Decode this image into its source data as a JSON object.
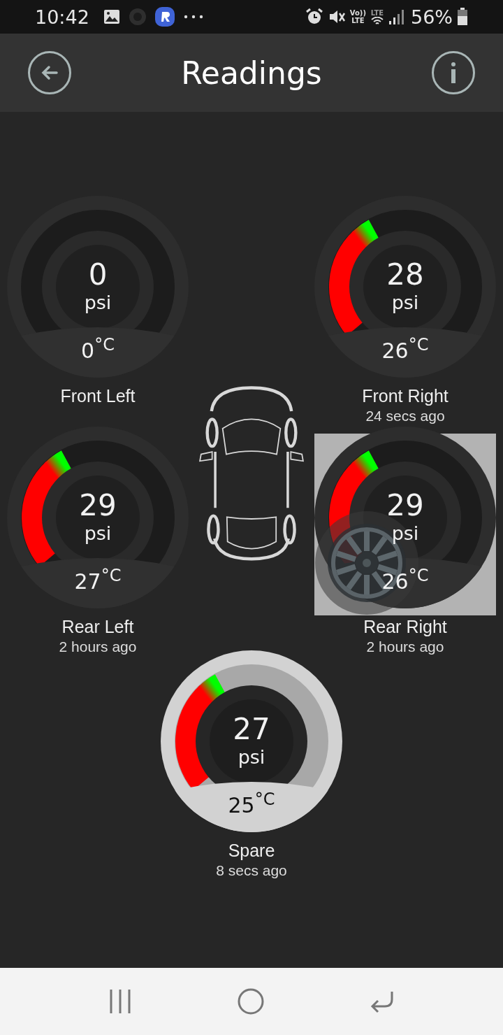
{
  "status_bar": {
    "time": "10:42",
    "network_labels": [
      "Vo))",
      "LTE",
      "LTE"
    ],
    "battery": "56%"
  },
  "app_bar": {
    "title": "Readings"
  },
  "tires": [
    {
      "name": "Front Left",
      "pressure": "0",
      "unit": "psi",
      "temperature": "0",
      "temp_unit": "°C",
      "active": false,
      "kind": "dark",
      "selected": false
    },
    {
      "name": "Front Right",
      "pressure": "28",
      "unit": "psi",
      "temperature": "26",
      "temp_unit": "°C",
      "updated": "24 secs ago",
      "active": true,
      "kind": "dark",
      "selected": false
    },
    {
      "name": "Rear Left",
      "pressure": "29",
      "unit": "psi",
      "temperature": "27",
      "temp_unit": "°C",
      "updated": "2 hours ago",
      "active": true,
      "kind": "dark",
      "selected": false
    },
    {
      "name": "Rear Right",
      "pressure": "29",
      "unit": "psi",
      "temperature": "26",
      "temp_unit": "°C",
      "updated": "2 hours ago",
      "active": true,
      "kind": "dark",
      "selected": true
    },
    {
      "name": "Spare",
      "pressure": "27",
      "unit": "psi",
      "temperature": "25",
      "temp_unit": "°C",
      "updated": "8 secs ago",
      "active": true,
      "kind": "light",
      "selected": false
    }
  ]
}
